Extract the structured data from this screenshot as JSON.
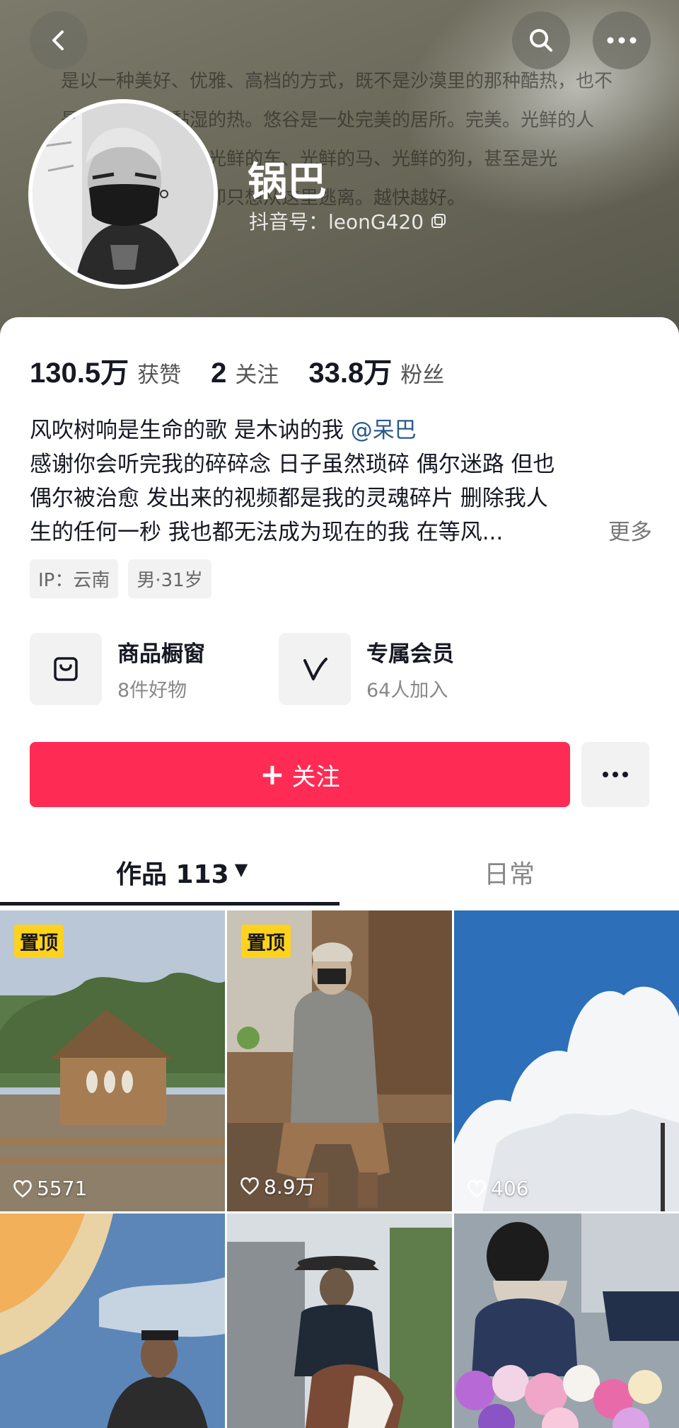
{
  "cover": {
    "lines": [
      "是以一种美好、优雅、高档的方式，既不是沙漠里的那种酷热，也不",
      "是　　　那种黏湿的热。悠谷是一处完美的居所。完美。光鲜的人",
      "　　　　鲜的宅、光鲜的车、光鲜的马、光鲜的狗，甚至是光",
      "",
      "　　　　路的男人却只想从这里逃离。越快越好。"
    ]
  },
  "profile": {
    "nickname": "锅巴",
    "account": "抖音号：leonG420"
  },
  "stats": [
    {
      "num": "130.5万",
      "label": "获赞"
    },
    {
      "num": "2",
      "label": "关注"
    },
    {
      "num": "33.8万",
      "label": "粉丝"
    }
  ],
  "bio": {
    "line1": "风吹树响是生命的歌 是木讷的我 ",
    "mention": "@呆巴",
    "line2": "感谢你会听完我的碎碎念 日子虽然琐碎 偶尔迷路 但也",
    "line3": "偶尔被治愈 发出来的视频都是我的灵魂碎片 删除我人",
    "line4": "生的任何一秒 我也都无法成为现在的我 在等风...",
    "more": "更多"
  },
  "tags": [
    "IP：云南",
    "男·31岁"
  ],
  "features": [
    {
      "title": "商品橱窗",
      "sub": "8件好物",
      "icon": "bag-icon"
    },
    {
      "title": "专属会员",
      "sub": "64人加入",
      "icon": "v-icon"
    }
  ],
  "follow": {
    "label": "关注"
  },
  "tabs": {
    "works": "作品 113",
    "daily": "日常"
  },
  "videos": [
    {
      "pinned": "置顶",
      "likes": "5571"
    },
    {
      "pinned": "置顶",
      "likes": "8.9万"
    },
    {
      "pinned": "",
      "likes": "406"
    },
    {
      "pinned": "",
      "likes": ""
    },
    {
      "pinned": "",
      "likes": ""
    },
    {
      "pinned": "",
      "likes": ""
    }
  ],
  "colors": {
    "accent": "#fe2c55",
    "pinned": "#ffd21e",
    "mention": "#2a5a8c"
  }
}
